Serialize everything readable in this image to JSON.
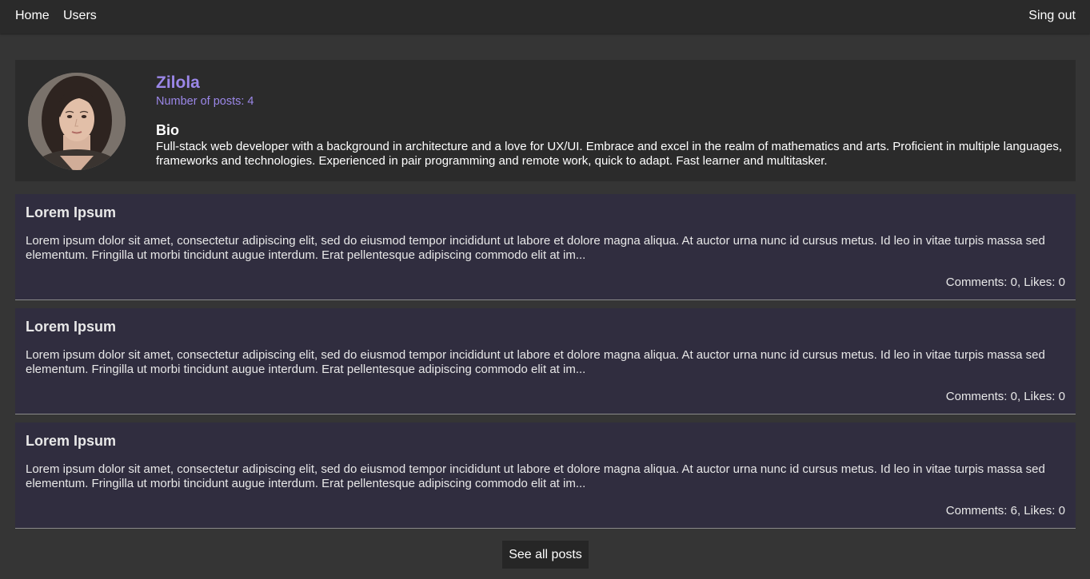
{
  "nav": {
    "home_label": "Home",
    "users_label": "Users",
    "signout_label": "Sing out"
  },
  "profile": {
    "name": "Zilola",
    "post_count": "Number of posts: 4",
    "bio_heading": "Bio",
    "bio_text": "Full-stack web developer with a background in architecture and a love for UX/UI. Embrace and excel in the realm of mathematics and arts. Proficient in multiple languages, frameworks and technologies. Experienced in pair programming and remote work, quick to adapt. Fast learner and multitasker."
  },
  "posts": [
    {
      "title": "Lorem Ipsum",
      "body": "Lorem ipsum dolor sit amet, consectetur adipiscing elit, sed do eiusmod tempor incididunt ut labore et dolore magna aliqua. At auctor urna nunc id cursus metus. Id leo in vitae turpis massa sed elementum. Fringilla ut morbi tincidunt augue interdum. Erat pellentesque adipiscing commodo elit at im...",
      "stats": "Comments: 0, Likes: 0"
    },
    {
      "title": "Lorem Ipsum",
      "body": "Lorem ipsum dolor sit amet, consectetur adipiscing elit, sed do eiusmod tempor incididunt ut labore et dolore magna aliqua. At auctor urna nunc id cursus metus. Id leo in vitae turpis massa sed elementum. Fringilla ut morbi tincidunt augue interdum. Erat pellentesque adipiscing commodo elit at im...",
      "stats": "Comments: 0, Likes: 0"
    },
    {
      "title": "Lorem Ipsum",
      "body": "Lorem ipsum dolor sit amet, consectetur adipiscing elit, sed do eiusmod tempor incididunt ut labore et dolore magna aliqua. At auctor urna nunc id cursus metus. Id leo in vitae turpis massa sed elementum. Fringilla ut morbi tincidunt augue interdum. Erat pellentesque adipiscing commodo elit at im...",
      "stats": "Comments: 6, Likes: 0"
    }
  ],
  "see_all_label": "See all posts",
  "colors": {
    "page_bg": "#353535",
    "navbar_bg": "#2a2a2a",
    "card_bg": "#2b2b2b",
    "post_bg": "#302d3f",
    "accent": "#9b87e8"
  }
}
